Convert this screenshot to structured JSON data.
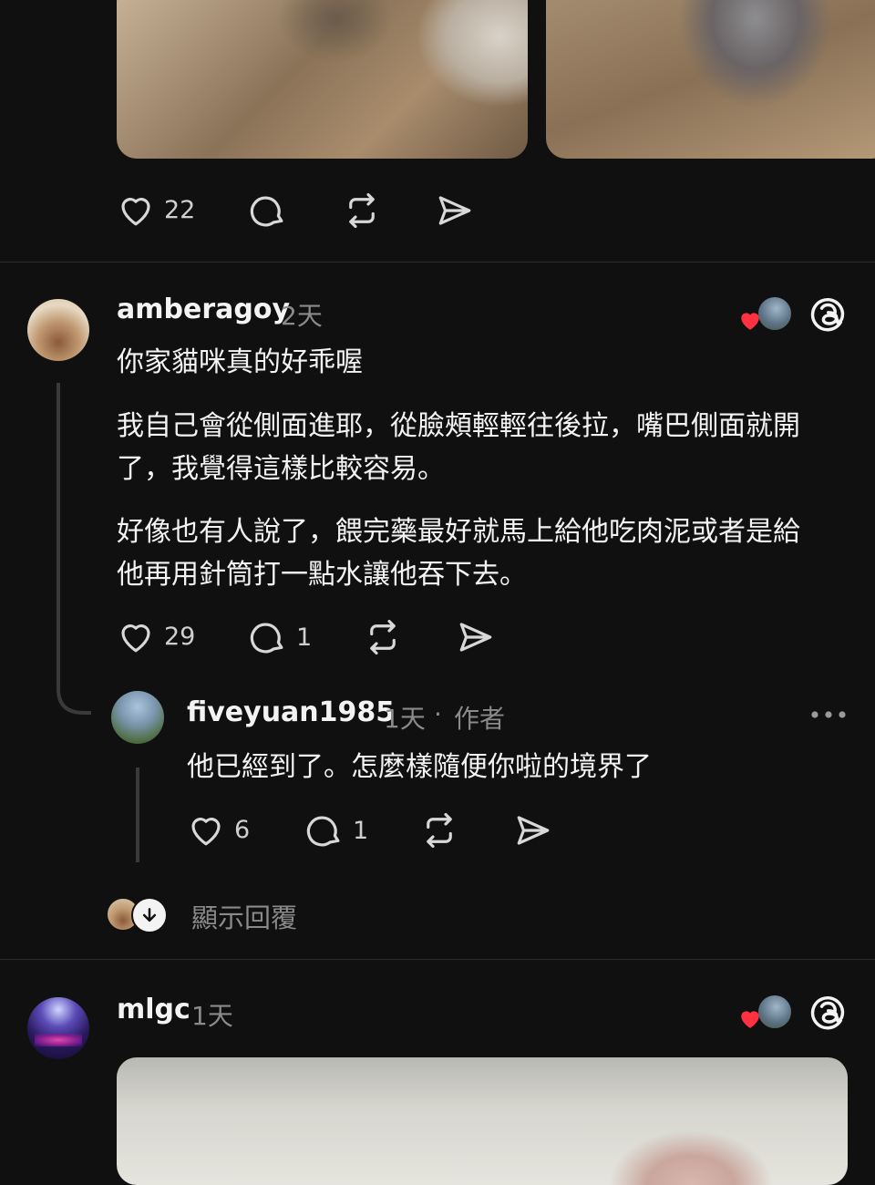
{
  "post_top": {
    "media_mute_icon": "speaker-muted-icon",
    "likes": "22"
  },
  "comment_1": {
    "username": "amberagoy",
    "time": "2天",
    "paragraphs": [
      "你家貓咪真的好乖喔",
      "我自己會從側面進耶，從臉頰輕輕往後拉，嘴巴側面就開",
      "了，我覺得這樣比較容易。",
      "好像也有人說了，餵完藥最好就馬上給他吃肉泥或者是給",
      "他再用針筒打一點水讓他吞下去。"
    ],
    "likes": "29",
    "replies": "1"
  },
  "reply_1": {
    "username": "fiveyuan1985",
    "time": "1天",
    "separator": "·",
    "author_tag": "作者",
    "text": "他已經到了。怎麼樣隨便你啦的境界了",
    "likes": "6",
    "replies": "1"
  },
  "show_replies": {
    "label": "顯示回覆"
  },
  "comment_2": {
    "username": "mlgc",
    "time": "1天"
  },
  "colors": {
    "background": "#101010",
    "heart_red": "#ff3040",
    "muted_text": "#8a8a8a"
  }
}
